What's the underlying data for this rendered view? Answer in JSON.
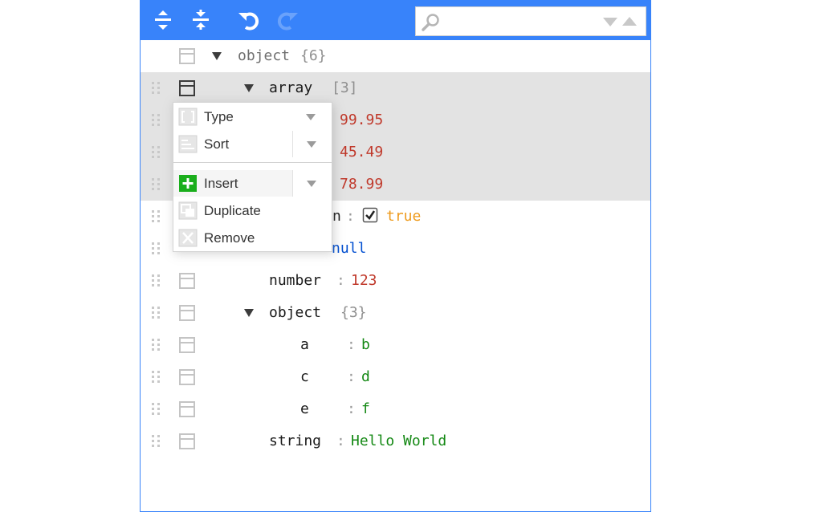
{
  "menubar": {
    "expand_all": "expand-all",
    "collapse_all": "collapse-all",
    "undo": "undo",
    "redo": "redo",
    "search_placeholder": ""
  },
  "colors": {
    "accent": "#3883fa",
    "number": "#c0392b",
    "string": "#158915",
    "boolean": "#ee9a1b",
    "null": "#004ed0",
    "selected_row": "#e3e3e3",
    "insert_icon": "#1aae1c"
  },
  "tree": {
    "root": {
      "field": "object",
      "count": "{6}"
    },
    "array": {
      "field": "array",
      "count": "[3]"
    },
    "array_values": [
      "99.95",
      "45.49",
      "78.99"
    ],
    "boolean": {
      "field_visible": "n",
      "sep": ":",
      "value": "true",
      "checked": true
    },
    "null": {
      "value": "null"
    },
    "number": {
      "field": "number",
      "sep": ":",
      "value": "123"
    },
    "object": {
      "field": "object",
      "count": "{3}"
    },
    "object_items": [
      {
        "field": "a",
        "sep": ":",
        "value": "b"
      },
      {
        "field": "c",
        "sep": ":",
        "value": "d"
      },
      {
        "field": "e",
        "sep": ":",
        "value": "f"
      }
    ],
    "string": {
      "field": "string",
      "sep": ":",
      "value": "Hello World"
    }
  },
  "context_menu": {
    "items": [
      {
        "label": "Type",
        "icon": "type-icon"
      },
      {
        "label": "Sort",
        "icon": "sort-icon"
      },
      {
        "label": "Insert",
        "icon": "insert-plus-icon"
      },
      {
        "label": "Duplicate",
        "icon": "duplicate-icon"
      },
      {
        "label": "Remove",
        "icon": "remove-icon"
      }
    ]
  }
}
